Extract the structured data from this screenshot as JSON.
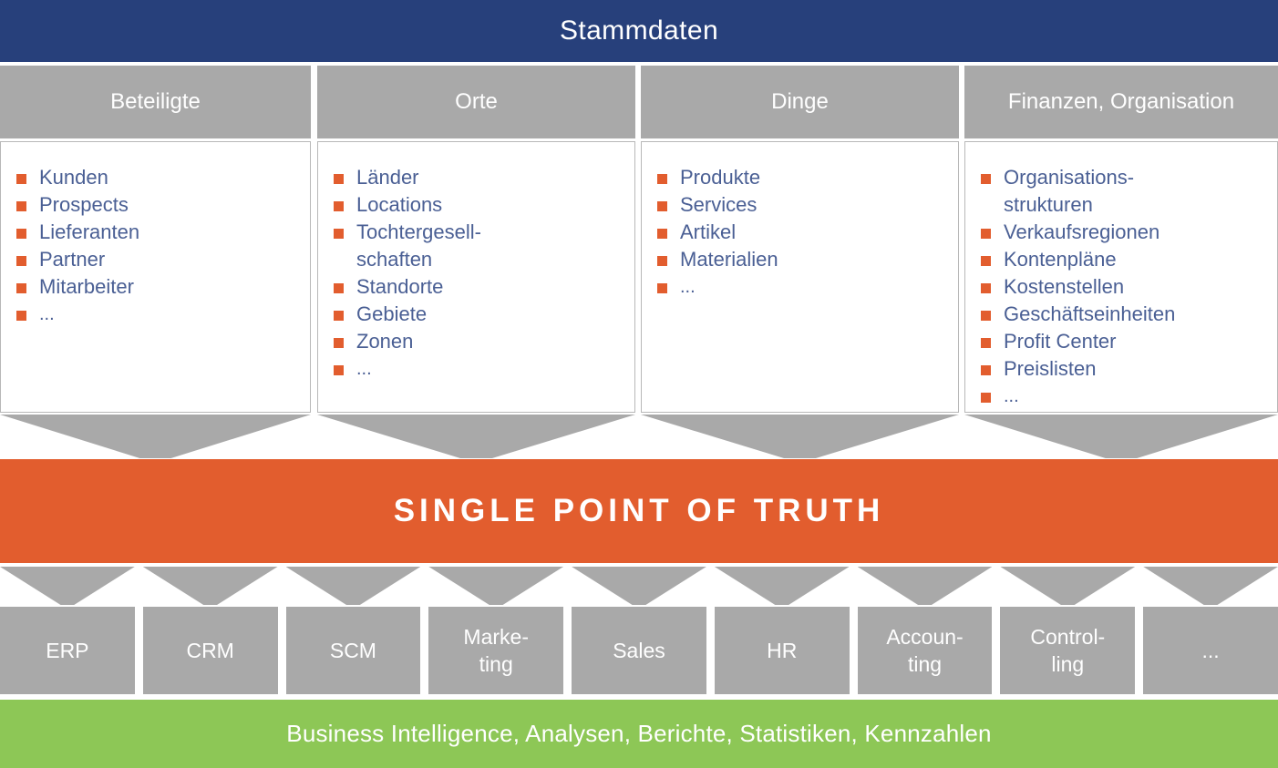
{
  "colors": {
    "header_blue": "#27407b",
    "accent_orange": "#e25d2e",
    "tile_gray": "#a9a9a9",
    "bi_green": "#8dc756",
    "list_text_blue": "#4a5f94"
  },
  "banner": {
    "title": "Stammdaten"
  },
  "columns": [
    {
      "header": "Beteiligte",
      "items": [
        "Kunden",
        "Prospects",
        "Lieferanten",
        "Partner",
        "Mitarbeiter",
        "..."
      ]
    },
    {
      "header": "Orte",
      "items": [
        "Länder",
        "Locations",
        "Tochtergesell-\nschaften",
        "Standorte",
        "Gebiete",
        "Zonen",
        "..."
      ]
    },
    {
      "header": "Dinge",
      "items": [
        "Produkte",
        "Services",
        "Artikel",
        "Materialien",
        "..."
      ]
    },
    {
      "header": "Finanzen, Organisation",
      "items": [
        "Organisations-\nstrukturen",
        "Verkaufsregionen",
        "Kontenpläne",
        "Kostenstellen",
        "Geschäftseinheiten",
        "Profit Center",
        "Preislisten",
        "..."
      ]
    }
  ],
  "single_point": {
    "label": "SINGLE POINT OF TRUTH"
  },
  "tiles": [
    "ERP",
    "CRM",
    "SCM",
    "Marke-\nting",
    "Sales",
    "HR",
    "Accoun-\nting",
    "Control-\nling",
    "..."
  ],
  "footer": {
    "label": "Business Intelligence, Analysen, Berichte, Statistiken, Kennzahlen"
  }
}
